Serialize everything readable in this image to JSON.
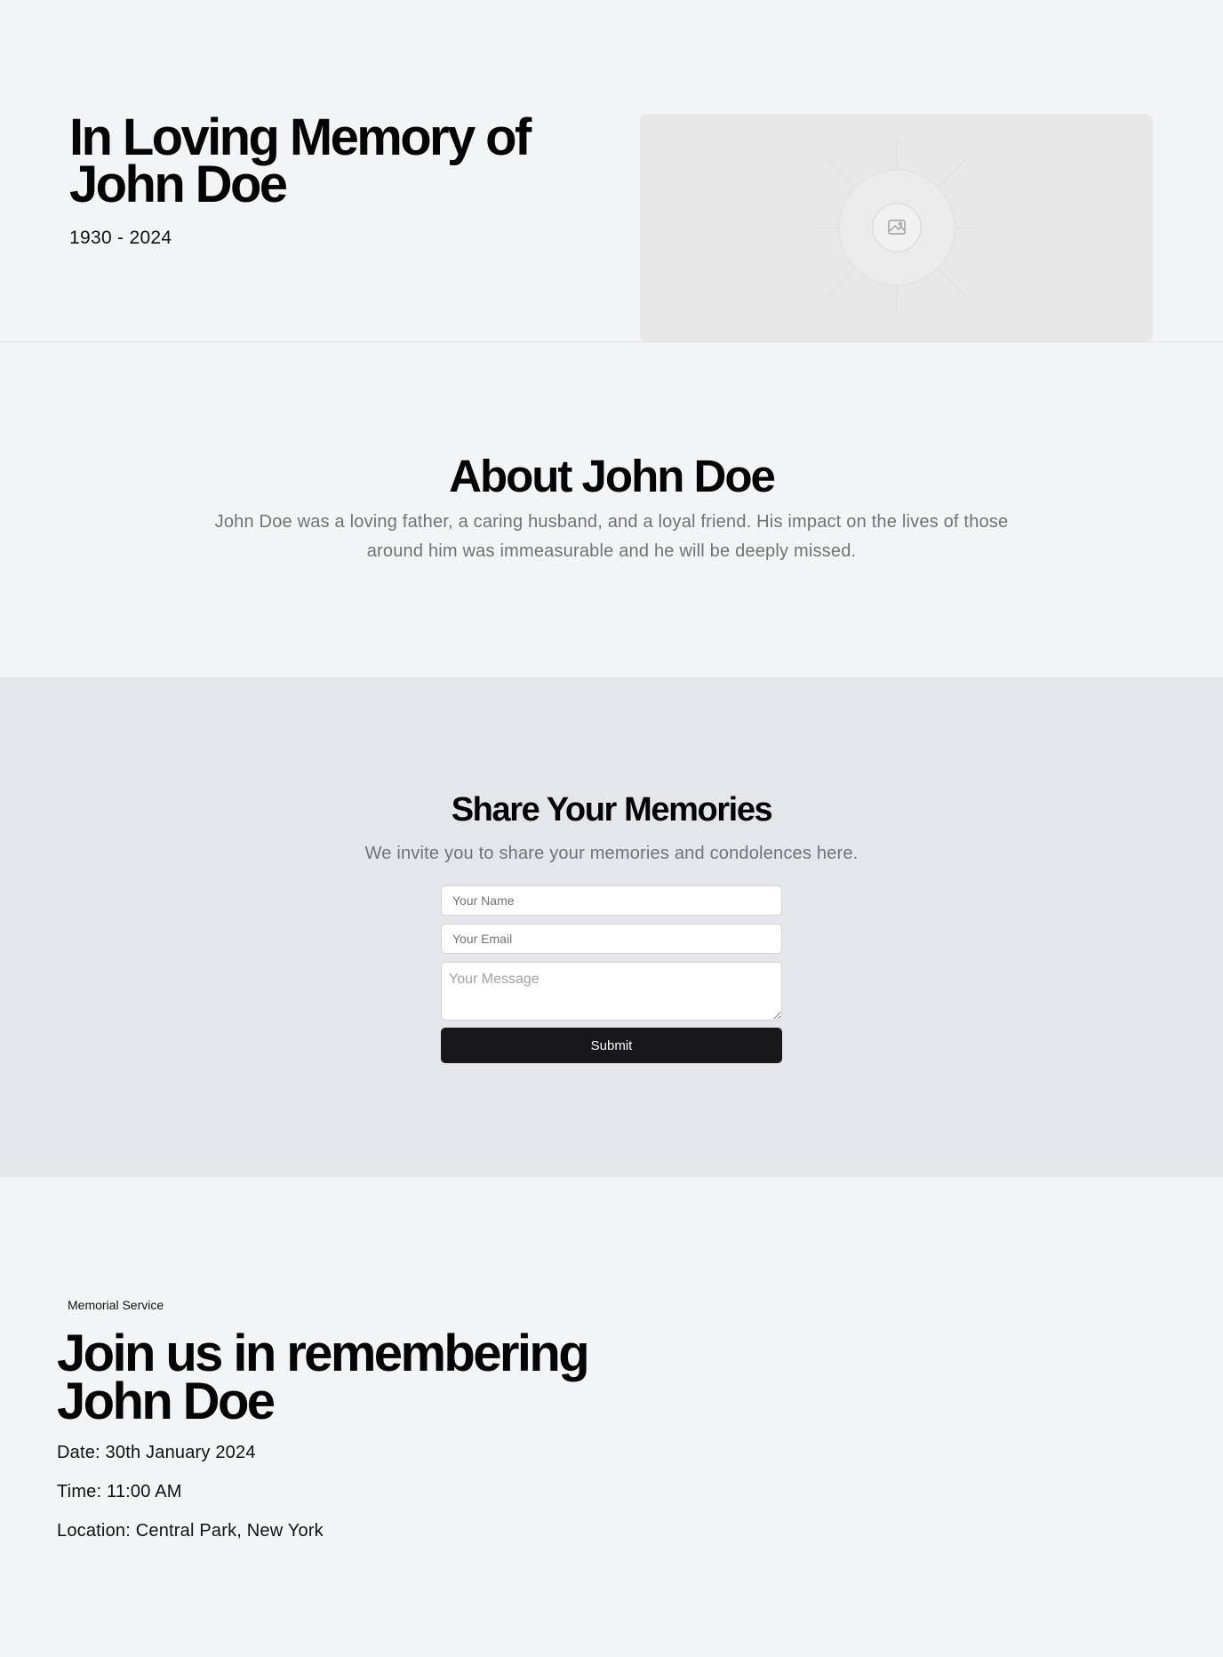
{
  "hero": {
    "title": "In Loving Memory of John Doe",
    "dates": "1930 - 2024",
    "image_icon": "image-placeholder-icon"
  },
  "about": {
    "title": "About John Doe",
    "text": "John Doe was a loving father, a caring husband, and a loyal friend. His impact on the lives of those around him was immeasurable and he will be deeply missed."
  },
  "memories": {
    "title": "Share Your Memories",
    "subtitle": "We invite you to share your memories and condolences here.",
    "form": {
      "name_placeholder": "Your Name",
      "email_placeholder": "Your Email",
      "message_placeholder": "Your Message",
      "name_value": "",
      "email_value": "",
      "message_value": "",
      "submit_label": "Submit"
    }
  },
  "service": {
    "badge": "Memorial Service",
    "title": "Join us in remembering John Doe",
    "date": "Date: 30th January 2024",
    "time": "Time: 11:00 AM",
    "location": "Location: Central Park, New York"
  },
  "colors": {
    "page_background": "#f3f4f6",
    "memories_background": "#e5e6ea",
    "button_background": "#18181b",
    "muted_text": "#71717a"
  }
}
